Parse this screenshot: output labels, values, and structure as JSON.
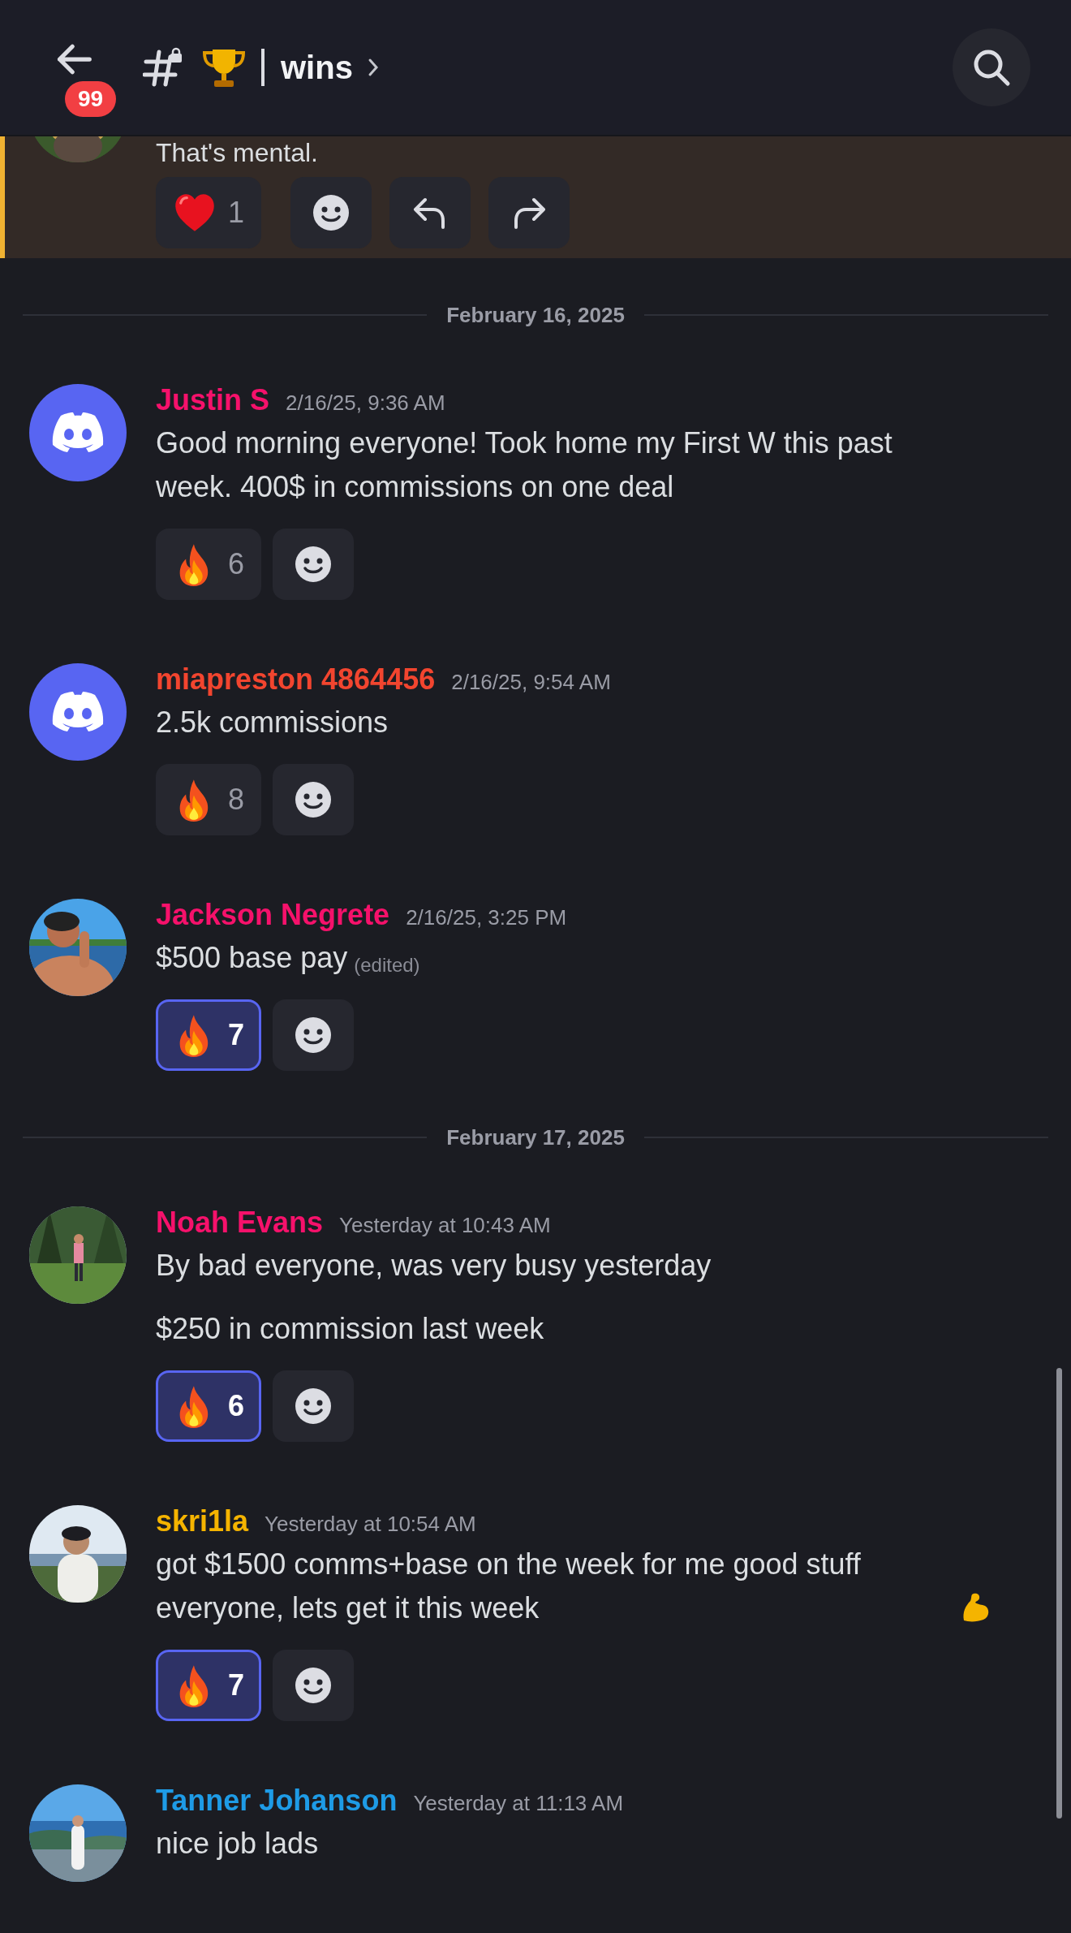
{
  "header": {
    "unread_badge": "99",
    "channel": "wins"
  },
  "top_message": {
    "text": "That's mental.",
    "highlighted": true,
    "reactions": [
      {
        "kind": "heart",
        "count": "1",
        "selected": false
      }
    ]
  },
  "feed": [
    {
      "kind": "divider",
      "label": "February 16, 2025"
    },
    {
      "kind": "message",
      "author": "Justin S",
      "color": "#f6116b",
      "timestamp": "2/16/25, 9:36 AM",
      "avatar": {
        "kind": "logo"
      },
      "paragraphs": [
        "Good morning everyone! Took home my First W this past week. 400$ in commissions on one deal"
      ],
      "reactions": [
        {
          "kind": "fire",
          "count": "6",
          "selected": false
        }
      ]
    },
    {
      "kind": "message",
      "author": "miapreston 4864456",
      "color": "#f2452f",
      "timestamp": "2/16/25, 9:54 AM",
      "avatar": {
        "kind": "logo"
      },
      "paragraphs": [
        "2.5k commissions"
      ],
      "reactions": [
        {
          "kind": "fire",
          "count": "8",
          "selected": false
        }
      ]
    },
    {
      "kind": "message",
      "author": "Jackson Negrete",
      "color": "#f6116b",
      "timestamp": "2/16/25, 3:25 PM",
      "avatar": {
        "kind": "lake"
      },
      "paragraphs": [
        "$500 base pay"
      ],
      "edited_label": "(edited)",
      "reactions": [
        {
          "kind": "fire",
          "count": "7",
          "selected": true
        }
      ]
    },
    {
      "kind": "divider",
      "label": "February 17, 2025"
    },
    {
      "kind": "message",
      "author": "Noah Evans",
      "color": "#f6116b",
      "timestamp": "Yesterday at 10:43 AM",
      "avatar": {
        "kind": "forest"
      },
      "paragraphs": [
        "By bad everyone, was very busy yesterday",
        "$250 in commission last week"
      ],
      "reactions": [
        {
          "kind": "fire",
          "count": "6",
          "selected": true
        }
      ]
    },
    {
      "kind": "message",
      "author": "skri1la",
      "color": "#f5b400",
      "timestamp": "Yesterday at 10:54 AM",
      "avatar": {
        "kind": "sky"
      },
      "paragraphs": [
        "got $1500 comms+base on the week for me good stuff everyone, lets get it this week"
      ],
      "trailing": {
        "kind": "muscle"
      },
      "reactions": [
        {
          "kind": "fire",
          "count": "7",
          "selected": true
        }
      ]
    },
    {
      "kind": "message",
      "author": "Tanner Johanson",
      "color": "#1e9be6",
      "timestamp": "Yesterday at 11:13 AM",
      "avatar": {
        "kind": "coast"
      },
      "paragraphs": [
        "nice job lads"
      ]
    }
  ]
}
